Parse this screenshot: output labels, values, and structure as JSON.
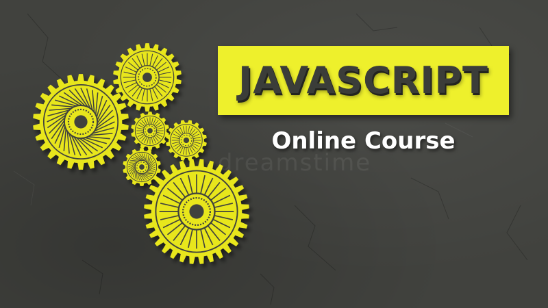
{
  "title": "JAVASCRIPT",
  "subtitle": "Online Course",
  "watermark": "dreamstime",
  "colors": {
    "background": "#41423e",
    "accent_yellow": "#eef02c",
    "gear_yellow": "#e8e61e",
    "title_text": "#3b3d39",
    "subtitle_text": "#ffffff"
  }
}
